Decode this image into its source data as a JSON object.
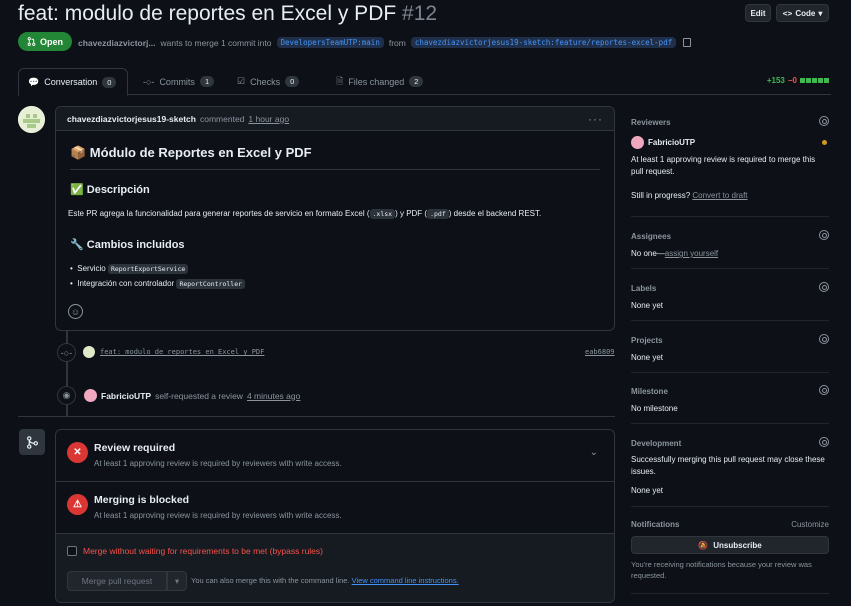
{
  "header": {
    "title": "feat: modulo de reportes en Excel y PDF",
    "number": "#12",
    "edit_label": "Edit",
    "code_label": "Code",
    "status": "Open",
    "author": "chavezdiazvictorj...",
    "merge_text": "wants to merge 1 commit into",
    "base_branch": "DevelopersTeamUTP:main",
    "from_text": "from",
    "head_branch": "chavezdiazvictorjesus19-sketch:feature/reportes-excel-pdf"
  },
  "tabs": [
    {
      "label": "Conversation",
      "count": "0"
    },
    {
      "label": "Commits",
      "count": "1"
    },
    {
      "label": "Checks",
      "count": "0"
    },
    {
      "label": "Files changed",
      "count": "2"
    }
  ],
  "diffstat": {
    "additions": "+153",
    "deletions": "−0"
  },
  "comment": {
    "author": "chavezdiazvictorjesus19-sketch",
    "action": "commented",
    "time": "1 hour ago",
    "heading": "📦 Módulo de Reportes en Excel y PDF",
    "desc_heading": "✅ Descripción",
    "desc_pre": "Este PR agrega la funcionalidad para generar reportes de servicio en formato Excel (",
    "desc_code1": ".xlsx",
    "desc_mid": ") y PDF (",
    "desc_code2": ".pdf",
    "desc_post": ") desde el backend REST.",
    "changes_heading": "🔧 Cambios incluidos",
    "changes": [
      {
        "label": "Servicio",
        "code": "ReportExportService"
      },
      {
        "label": "Integración con controlador",
        "code": "ReportController"
      }
    ]
  },
  "timeline": {
    "commit_message": "feat: modulo de reportes en Excel y PDF",
    "commit_sha": "eab6809",
    "review_user": "FabricioUTP",
    "review_action": "self-requested a review",
    "review_time": "4 minutes ago"
  },
  "merge": {
    "review_title": "Review required",
    "review_sub": "At least 1 approving review is required by reviewers with write access.",
    "blocked_title": "Merging is blocked",
    "blocked_sub": "At least 1 approving review is required by reviewers with write access.",
    "bypass_label": "Merge without waiting for requirements to be met (bypass rules)",
    "merge_button": "Merge pull request",
    "cmd_text": "You can also merge this with the command line.",
    "cmd_link": "View command line instructions."
  },
  "sidebar": {
    "reviewers": {
      "heading": "Reviewers",
      "user": "FabricioUTP",
      "note": "At least 1 approving review is required to merge this pull request.",
      "progress_q": "Still in progress?",
      "draft_link": "Convert to draft"
    },
    "assignees": {
      "heading": "Assignees",
      "value": "No one—",
      "link": "assign yourself"
    },
    "labels": {
      "heading": "Labels",
      "value": "None yet"
    },
    "projects": {
      "heading": "Projects",
      "value": "None yet"
    },
    "milestone": {
      "heading": "Milestone",
      "value": "No milestone"
    },
    "development": {
      "heading": "Development",
      "note": "Successfully merging this pull request may close these issues.",
      "value": "None yet"
    },
    "notifications": {
      "heading": "Notifications",
      "customize": "Customize",
      "button": "Unsubscribe",
      "note": "You're receiving notifications because your review was requested."
    }
  },
  "colors": {
    "open_green": "#238636",
    "danger_red": "#da3633",
    "link_blue": "#4493f8",
    "pending_orange": "#d29922"
  }
}
